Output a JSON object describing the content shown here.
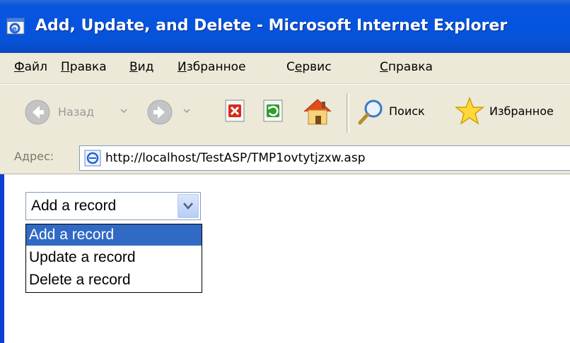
{
  "window": {
    "title": "Add, Update, and Delete - Microsoft Internet Explorer"
  },
  "menu": {
    "items": [
      {
        "label": "Файл",
        "accel": "Ф",
        "rest": "айл"
      },
      {
        "label": "Правка",
        "accel": "П",
        "rest": "равка"
      },
      {
        "label": "Вид",
        "accel": "В",
        "rest": "ид"
      },
      {
        "label": "Избранное",
        "accel": "И",
        "rest": "збранное"
      },
      {
        "label": "Сервис",
        "pre": "С",
        "accel": "е",
        "rest": "рвис"
      },
      {
        "label": "Справка",
        "accel": "С",
        "rest": "правка"
      }
    ]
  },
  "toolbar": {
    "back_label": "Назад",
    "search_label": "Поиск",
    "favorites_label": "Избранное"
  },
  "address": {
    "label": "Адрес:",
    "url": "http://localhost/TestASP/TMP1ovtytjzxw.asp"
  },
  "select": {
    "current_value": "Add a record",
    "options": [
      "Add a record",
      "Update a record",
      "Delete a record"
    ],
    "highlighted_index": 0
  },
  "colors": {
    "titlebar": "#0454e0",
    "chrome": "#ece9d8",
    "selection": "#316ac5"
  }
}
